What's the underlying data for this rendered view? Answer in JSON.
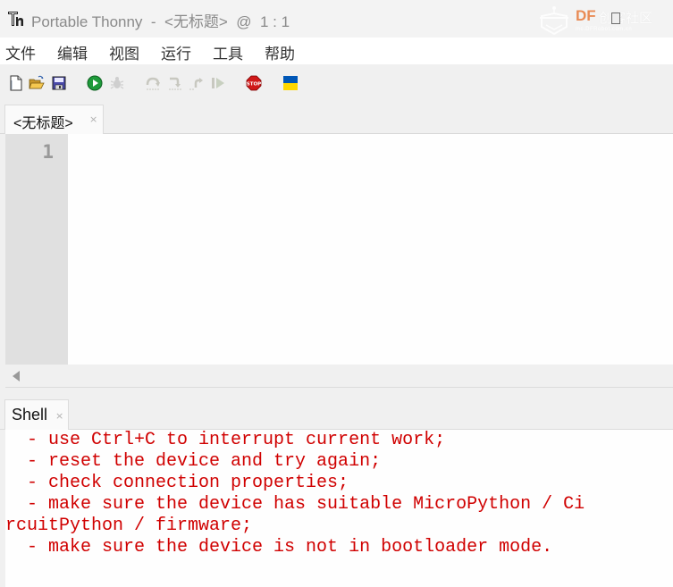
{
  "window": {
    "title": "Portable Thonny  -  <无标题>  @  1 : 1"
  },
  "watermark": {
    "brand": "DF",
    "brand_cn": "创客社区",
    "url": "mc.DFRobot.com.cn"
  },
  "menubar": {
    "items": [
      {
        "label": "文件"
      },
      {
        "label": "编辑"
      },
      {
        "label": "视图"
      },
      {
        "label": "运行"
      },
      {
        "label": "工具"
      },
      {
        "label": "帮助"
      }
    ]
  },
  "toolbar": {
    "buttons": [
      {
        "name": "new-file",
        "icon": "new-file-icon",
        "enabled": true
      },
      {
        "name": "open-file",
        "icon": "open-folder-icon",
        "enabled": true
      },
      {
        "name": "save-file",
        "icon": "save-disk-icon",
        "enabled": true
      },
      {
        "name": "run",
        "icon": "run-play-icon",
        "enabled": true
      },
      {
        "name": "debug",
        "icon": "bug-icon",
        "enabled": false
      },
      {
        "name": "step-over",
        "icon": "step-over-icon",
        "enabled": false
      },
      {
        "name": "step-into",
        "icon": "step-into-icon",
        "enabled": false
      },
      {
        "name": "step-out",
        "icon": "step-out-icon",
        "enabled": false
      },
      {
        "name": "resume",
        "icon": "resume-icon",
        "enabled": false
      },
      {
        "name": "stop",
        "icon": "stop-sign-icon",
        "enabled": true,
        "label": "STOP"
      },
      {
        "name": "ukraine-flag",
        "icon": "ukraine-flag-icon",
        "enabled": true
      }
    ],
    "colors": {
      "run_green": "#1e9a3a",
      "stop_red": "#d01818",
      "flag_blue": "#0057b7",
      "flag_yellow": "#ffd700"
    }
  },
  "editor": {
    "tabs": [
      {
        "label": "<无标题>",
        "close": "×",
        "active": true
      }
    ],
    "line_numbers": [
      "1"
    ],
    "content": ""
  },
  "shell": {
    "tab": {
      "label": "Shell",
      "close": "×"
    },
    "lines": [
      "  - use Ctrl+C to interrupt current work;",
      "  - reset the device and try again;",
      "  - check connection properties;",
      "  - make sure the device has suitable MicroPython / Ci",
      "rcuitPython / firmware;",
      "  - make sure the device is not in bootloader mode."
    ],
    "text_color": "#d00000"
  }
}
